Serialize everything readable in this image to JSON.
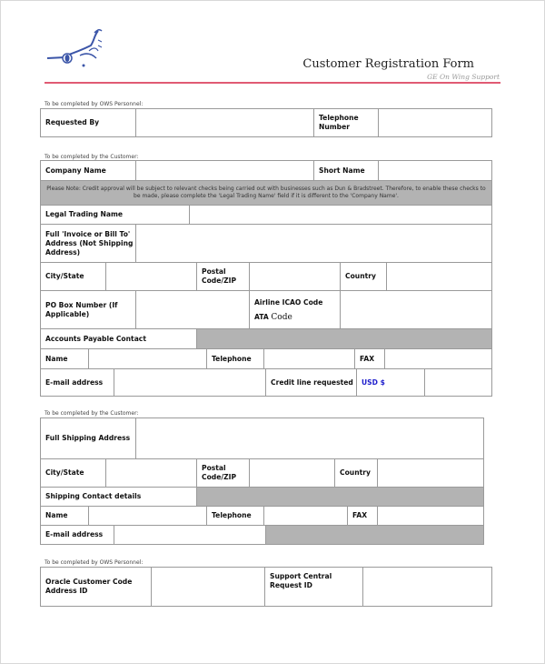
{
  "header": {
    "logo_icon": "ge-on-wing-support-logo",
    "title": "Customer Registration Form",
    "subtitle": "GE On Wing Support"
  },
  "sections": {
    "ows_top_caption": "To be completed by OWS Personnel:",
    "customer_caption": "To be completed by the Customer:",
    "shipping_caption": "To be completed by the Customer:",
    "ows_bottom_caption": "To be completed by OWS Personnel:"
  },
  "requested": {
    "requested_by": "Requested By",
    "telephone_number": "Telephone Number"
  },
  "customer": {
    "company_name": "Company Name",
    "short_name": "Short Name",
    "note": "Please Note: Credit approval will be subject to relevant checks being carried out with businesses such as Dun & Bradstreet.  Therefore, to enable these checks to be made, please complete the 'Legal Trading Name' field if it is different to the 'Company Name'.",
    "legal_trading_name": "Legal Trading Name",
    "invoice_address": "Full 'Invoice or Bill To' Address (Not Shipping Address)",
    "city_state": "City/State",
    "postal_code": "Postal Code/ZIP",
    "country": "Country",
    "po_box": "PO Box Number (If Applicable)",
    "airline_icao": "Airline ICAO Code",
    "ata_prefix": "ATA",
    "ata_code": "Code",
    "accounts_payable": "Accounts Payable Contact",
    "name": "Name",
    "telephone": "Telephone",
    "fax": "FAX",
    "email": "E-mail address",
    "credit_line": "Credit line requested",
    "usd": "USD $"
  },
  "shipping": {
    "full_shipping_address": "Full Shipping Address",
    "city_state": "City/State",
    "postal_code": "Postal Code/ZIP",
    "country": "Country",
    "contact_details": "Shipping Contact details",
    "name": "Name",
    "telephone": "Telephone",
    "fax": "FAX",
    "email": "E-mail address"
  },
  "ows_bottom": {
    "oracle_code": "Oracle Customer Code Address ID",
    "support_central": "Support Central Request ID"
  }
}
